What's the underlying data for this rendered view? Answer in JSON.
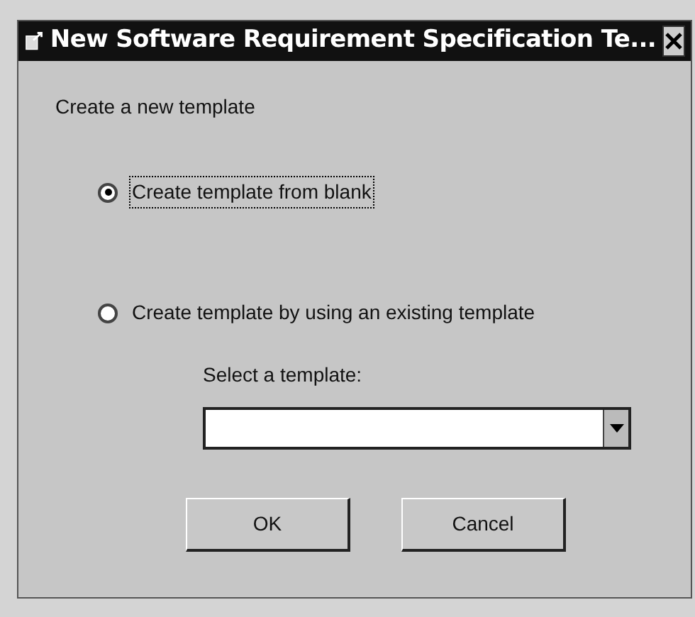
{
  "window": {
    "title": "New Software Requirement Specification Te..."
  },
  "heading": "Create a new template",
  "options": [
    {
      "label": "Create template from blank",
      "selected": true,
      "focused": true
    },
    {
      "label": "Create template by using an existing template",
      "selected": false,
      "focused": false
    }
  ],
  "template_select": {
    "label": "Select a template:"
  },
  "buttons": [
    "OK",
    "Cancel"
  ]
}
